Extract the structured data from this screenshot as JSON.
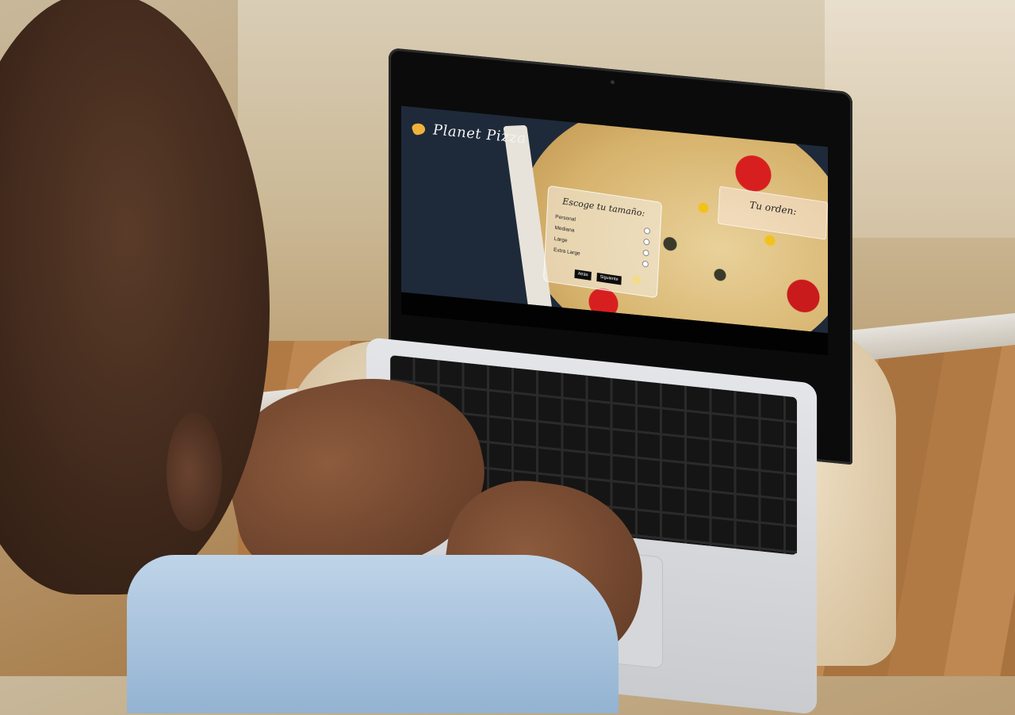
{
  "screen": {
    "brand": "Planet Pizza",
    "size_card": {
      "title": "Escoge tu tamaño:",
      "options": [
        "Personal",
        "Mediana",
        "Large",
        "Extra Large"
      ],
      "back_button": "Atrás",
      "next_button": "Siguiente"
    },
    "order_card": {
      "title": "Tu orden:"
    }
  }
}
